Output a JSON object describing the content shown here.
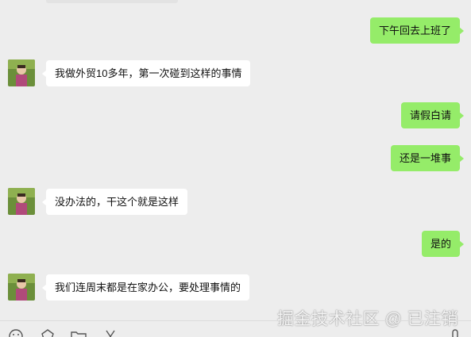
{
  "messages": [
    {
      "side": "right",
      "text": "下午回去上班了"
    },
    {
      "side": "left",
      "text": "我做外贸10多年，第一次碰到这样的事情"
    },
    {
      "side": "right",
      "text": "请假白请"
    },
    {
      "side": "right",
      "text": "还是一堆事"
    },
    {
      "side": "left",
      "text": "没办法的，干这个就是这样"
    },
    {
      "side": "right",
      "text": "是的"
    },
    {
      "side": "left",
      "text": "我们连周末都是在家办公，要处理事情的"
    }
  ],
  "watermark": "掘金技术社区 @ 已注销",
  "colors": {
    "background": "#ededed",
    "sent_bubble": "#95ec69",
    "received_bubble": "#ffffff"
  },
  "toolbar": {
    "icons": [
      "emoji-icon",
      "favorites-icon",
      "folder-icon",
      "scissors-icon",
      "microphone-icon"
    ]
  }
}
